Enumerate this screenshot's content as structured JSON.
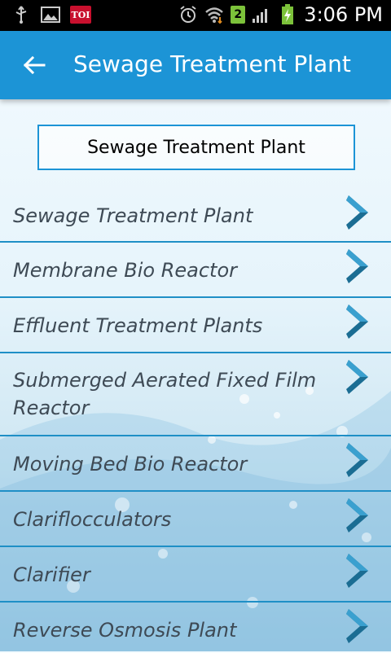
{
  "status_bar": {
    "toi_label": "TOI",
    "notification_count": "2",
    "time": "3:06 PM",
    "icons": [
      "usb-icon",
      "image-icon",
      "toi-app-icon",
      "alarm-icon",
      "wifi-icon",
      "signal-icon",
      "battery-charging-icon"
    ]
  },
  "app_bar": {
    "title": "Sewage Treatment Plant",
    "back_icon": "arrow-left-icon",
    "color": "#1c94d6"
  },
  "header_box": {
    "label": "Sewage Treatment Plant"
  },
  "list": {
    "items": [
      {
        "label": "Sewage Treatment Plant"
      },
      {
        "label": "Membrane Bio Reactor"
      },
      {
        "label": "Effluent Treatment Plants"
      },
      {
        "label": " Submerged Aerated Fixed Film Reactor"
      },
      {
        "label": "Moving Bed Bio Reactor"
      },
      {
        "label": "Clariflocculators"
      },
      {
        "label": "Clarifier"
      },
      {
        "label": "Reverse Osmosis Plant"
      }
    ],
    "chevron_icon": "chevron-right-icon",
    "divider_color": "#1f8fc6"
  }
}
